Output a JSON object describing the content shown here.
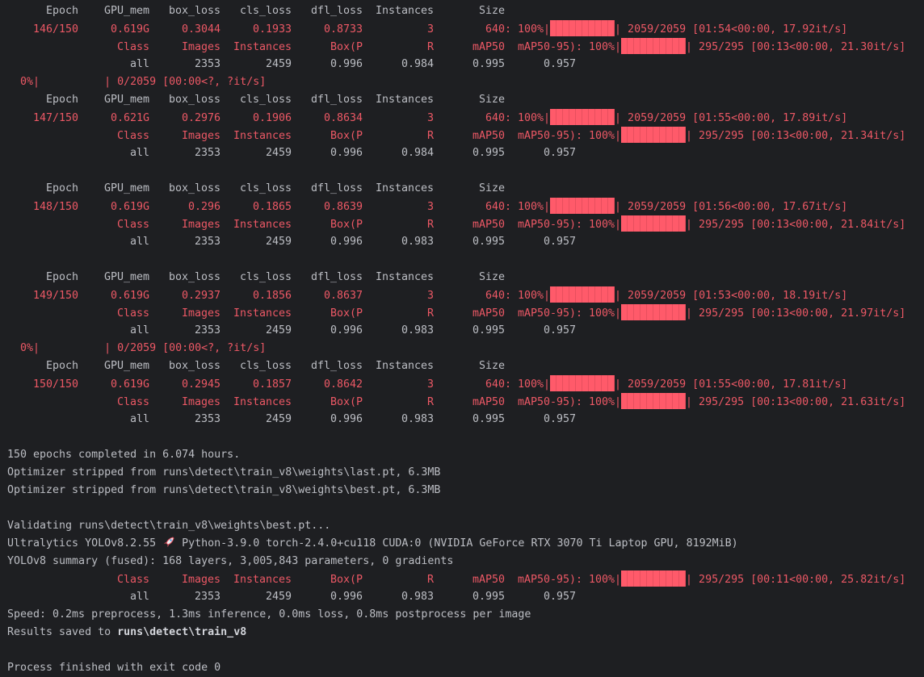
{
  "colors": {
    "background": "#1e1f22",
    "text": "#bcbec4",
    "accent_red": "#ec5865",
    "bar_fill": "#ff5a6a"
  },
  "lines": [
    {
      "kind": "row",
      "style": "grey",
      "cols": [
        "Epoch",
        "GPU_mem",
        "box_loss",
        "cls_loss",
        "dfl_loss",
        "Instances",
        "Size"
      ]
    },
    {
      "kind": "row",
      "style": "red",
      "cols": [
        "146/150",
        "0.619G",
        "0.3044",
        "0.1933",
        "0.8733",
        "3",
        "640"
      ],
      "progress": {
        "label": ": 100%|",
        "pct": 100,
        "stats": "| 2059/2059 [01:54<00:00, 17.92it/s]"
      }
    },
    {
      "kind": "row",
      "style": "red",
      "wide_first": true,
      "cols": [
        "Class",
        "Images",
        "Instances",
        "Box(P",
        "R",
        "mAP50",
        "mAP50-95)"
      ],
      "progress": {
        "label": ": 100%|",
        "pct": 100,
        "stats": "| 295/295 [00:13<00:00, 21.30it/s]"
      }
    },
    {
      "kind": "row",
      "style": "grey",
      "wide_first": true,
      "cols": [
        "all",
        "2353",
        "2459",
        "0.996",
        "0.984",
        "0.995",
        "0.957"
      ]
    },
    {
      "kind": "text",
      "style": "red",
      "segments": [
        {
          "t": "  0%|          | 0/2059 [00:00<?, ?it/s]"
        }
      ]
    },
    {
      "kind": "row",
      "style": "grey",
      "cols": [
        "Epoch",
        "GPU_mem",
        "box_loss",
        "cls_loss",
        "dfl_loss",
        "Instances",
        "Size"
      ]
    },
    {
      "kind": "row",
      "style": "red",
      "cols": [
        "147/150",
        "0.621G",
        "0.2976",
        "0.1906",
        "0.8634",
        "3",
        "640"
      ],
      "progress": {
        "label": ": 100%|",
        "pct": 100,
        "stats": "| 2059/2059 [01:55<00:00, 17.89it/s]"
      }
    },
    {
      "kind": "row",
      "style": "red",
      "wide_first": true,
      "cols": [
        "Class",
        "Images",
        "Instances",
        "Box(P",
        "R",
        "mAP50",
        "mAP50-95)"
      ],
      "progress": {
        "label": ": 100%|",
        "pct": 100,
        "stats": "| 295/295 [00:13<00:00, 21.34it/s]"
      }
    },
    {
      "kind": "row",
      "style": "grey",
      "wide_first": true,
      "cols": [
        "all",
        "2353",
        "2459",
        "0.996",
        "0.984",
        "0.995",
        "0.957"
      ]
    },
    {
      "kind": "blank"
    },
    {
      "kind": "row",
      "style": "grey",
      "cols": [
        "Epoch",
        "GPU_mem",
        "box_loss",
        "cls_loss",
        "dfl_loss",
        "Instances",
        "Size"
      ]
    },
    {
      "kind": "row",
      "style": "red",
      "cols": [
        "148/150",
        "0.619G",
        "0.296",
        "0.1865",
        "0.8639",
        "3",
        "640"
      ],
      "progress": {
        "label": ": 100%|",
        "pct": 100,
        "stats": "| 2059/2059 [01:56<00:00, 17.67it/s]"
      }
    },
    {
      "kind": "row",
      "style": "red",
      "wide_first": true,
      "cols": [
        "Class",
        "Images",
        "Instances",
        "Box(P",
        "R",
        "mAP50",
        "mAP50-95)"
      ],
      "progress": {
        "label": ": 100%|",
        "pct": 100,
        "stats": "| 295/295 [00:13<00:00, 21.84it/s]"
      }
    },
    {
      "kind": "row",
      "style": "grey",
      "wide_first": true,
      "cols": [
        "all",
        "2353",
        "2459",
        "0.996",
        "0.983",
        "0.995",
        "0.957"
      ]
    },
    {
      "kind": "blank"
    },
    {
      "kind": "row",
      "style": "grey",
      "cols": [
        "Epoch",
        "GPU_mem",
        "box_loss",
        "cls_loss",
        "dfl_loss",
        "Instances",
        "Size"
      ]
    },
    {
      "kind": "row",
      "style": "red",
      "cols": [
        "149/150",
        "0.619G",
        "0.2937",
        "0.1856",
        "0.8637",
        "3",
        "640"
      ],
      "progress": {
        "label": ": 100%|",
        "pct": 100,
        "stats": "| 2059/2059 [01:53<00:00, 18.19it/s]"
      }
    },
    {
      "kind": "row",
      "style": "red",
      "wide_first": true,
      "cols": [
        "Class",
        "Images",
        "Instances",
        "Box(P",
        "R",
        "mAP50",
        "mAP50-95)"
      ],
      "progress": {
        "label": ": 100%|",
        "pct": 100,
        "stats": "| 295/295 [00:13<00:00, 21.97it/s]"
      }
    },
    {
      "kind": "row",
      "style": "grey",
      "wide_first": true,
      "cols": [
        "all",
        "2353",
        "2459",
        "0.996",
        "0.983",
        "0.995",
        "0.957"
      ]
    },
    {
      "kind": "text",
      "style": "red",
      "segments": [
        {
          "t": "  0%|          | 0/2059 [00:00<?, ?it/s]"
        }
      ]
    },
    {
      "kind": "row",
      "style": "grey",
      "cols": [
        "Epoch",
        "GPU_mem",
        "box_loss",
        "cls_loss",
        "dfl_loss",
        "Instances",
        "Size"
      ]
    },
    {
      "kind": "row",
      "style": "red",
      "cols": [
        "150/150",
        "0.619G",
        "0.2945",
        "0.1857",
        "0.8642",
        "3",
        "640"
      ],
      "progress": {
        "label": ": 100%|",
        "pct": 100,
        "stats": "| 2059/2059 [01:55<00:00, 17.81it/s]"
      }
    },
    {
      "kind": "row",
      "style": "red",
      "wide_first": true,
      "cols": [
        "Class",
        "Images",
        "Instances",
        "Box(P",
        "R",
        "mAP50",
        "mAP50-95)"
      ],
      "progress": {
        "label": ": 100%|",
        "pct": 100,
        "stats": "| 295/295 [00:13<00:00, 21.63it/s]"
      }
    },
    {
      "kind": "row",
      "style": "grey",
      "wide_first": true,
      "cols": [
        "all",
        "2353",
        "2459",
        "0.996",
        "0.983",
        "0.995",
        "0.957"
      ]
    },
    {
      "kind": "blank"
    },
    {
      "kind": "text",
      "style": "grey",
      "segments": [
        {
          "t": "150 epochs completed in 6.074 hours."
        }
      ]
    },
    {
      "kind": "text",
      "style": "grey",
      "segments": [
        {
          "t": "Optimizer stripped from runs\\detect\\train_v8\\weights\\last.pt, 6.3MB"
        }
      ]
    },
    {
      "kind": "text",
      "style": "grey",
      "segments": [
        {
          "t": "Optimizer stripped from runs\\detect\\train_v8\\weights\\best.pt, 6.3MB"
        }
      ]
    },
    {
      "kind": "blank"
    },
    {
      "kind": "text",
      "style": "grey",
      "segments": [
        {
          "t": "Validating runs\\detect\\train_v8\\weights\\best.pt..."
        }
      ]
    },
    {
      "kind": "text",
      "style": "grey",
      "segments": [
        {
          "t": "Ultralytics YOLOv8.2.55 "
        },
        {
          "icon": "rocket-icon",
          "t": "🚀"
        },
        {
          "t": " Python-3.9.0 torch-2.4.0+cu118 CUDA:0 (NVIDIA GeForce RTX 3070 Ti Laptop GPU, 8192MiB)"
        }
      ]
    },
    {
      "kind": "text",
      "style": "grey",
      "segments": [
        {
          "t": "YOLOv8 summary (fused): 168 layers, 3,005,843 parameters, 0 gradients"
        }
      ]
    },
    {
      "kind": "row",
      "style": "red",
      "wide_first": true,
      "cols": [
        "Class",
        "Images",
        "Instances",
        "Box(P",
        "R",
        "mAP50",
        "mAP50-95)"
      ],
      "progress": {
        "label": ": 100%|",
        "pct": 100,
        "stats": "| 295/295 [00:11<00:00, 25.82it/s]"
      }
    },
    {
      "kind": "row",
      "style": "grey",
      "wide_first": true,
      "cols": [
        "all",
        "2353",
        "2459",
        "0.996",
        "0.983",
        "0.995",
        "0.957"
      ]
    },
    {
      "kind": "text",
      "style": "grey",
      "segments": [
        {
          "t": "Speed: 0.2ms preprocess, 1.3ms inference, 0.0ms loss, 0.8ms postprocess per image"
        }
      ]
    },
    {
      "kind": "text",
      "style": "grey",
      "segments": [
        {
          "t": "Results saved to "
        },
        {
          "t": "runs\\detect\\train_v8",
          "bold": true
        }
      ]
    },
    {
      "kind": "blank"
    },
    {
      "kind": "text",
      "style": "grey",
      "segments": [
        {
          "t": "Process finished with exit code 0"
        }
      ]
    }
  ]
}
